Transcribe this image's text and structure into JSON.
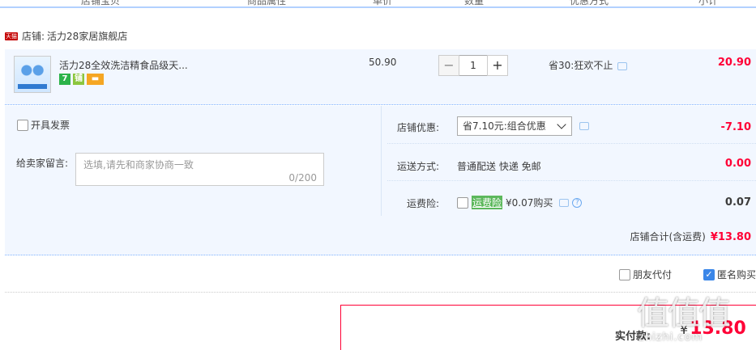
{
  "columns": [
    "店铺宝贝",
    "商品属性",
    "单价",
    "数量",
    "优惠方式",
    "小计"
  ],
  "shop": {
    "label": "店铺:",
    "name": "活力28家居旗舰店",
    "icon": "tmall-icon",
    "icon_text": "天猫"
  },
  "item": {
    "title": "活力28全效洗洁精食品级天...",
    "badges": [
      "7",
      "铺",
      "▬"
    ],
    "unit_price": "50.90",
    "quantity": "1",
    "minus": "−",
    "plus": "+",
    "discount": "省30:狂欢不止",
    "subtotal": "20.90"
  },
  "invoice": {
    "label": "开具发票"
  },
  "message": {
    "label": "给卖家留言:",
    "placeholder": "选填,请先和商家协商一致",
    "counter": "0/200"
  },
  "shop_discount": {
    "label": "店铺优惠:",
    "selected": "省7.10元:组合优惠",
    "amount": "-7.10"
  },
  "shipping": {
    "label": "运送方式:",
    "value": "普通配送 快递 免邮",
    "amount": "0.00"
  },
  "insurance": {
    "label": "运费险:",
    "tag": "运费险",
    "price": "¥0.07购买",
    "amount": "0.07",
    "help": "?"
  },
  "shop_total": {
    "label": "店铺合计(含运费)",
    "amount": "¥13.80"
  },
  "bottom": {
    "friend_pay": "朋友代付",
    "anonymous": "匿名购买"
  },
  "payment": {
    "label": "实付款:",
    "currency": "¥",
    "amount": "13.80"
  },
  "watermark": {
    "big": "值值值",
    "small": "zhizhi.com"
  },
  "colors": {
    "accent_red": "#ff0036",
    "light_blue_bg": "#f2f7ff",
    "checkbox_blue": "#3a86e8"
  }
}
